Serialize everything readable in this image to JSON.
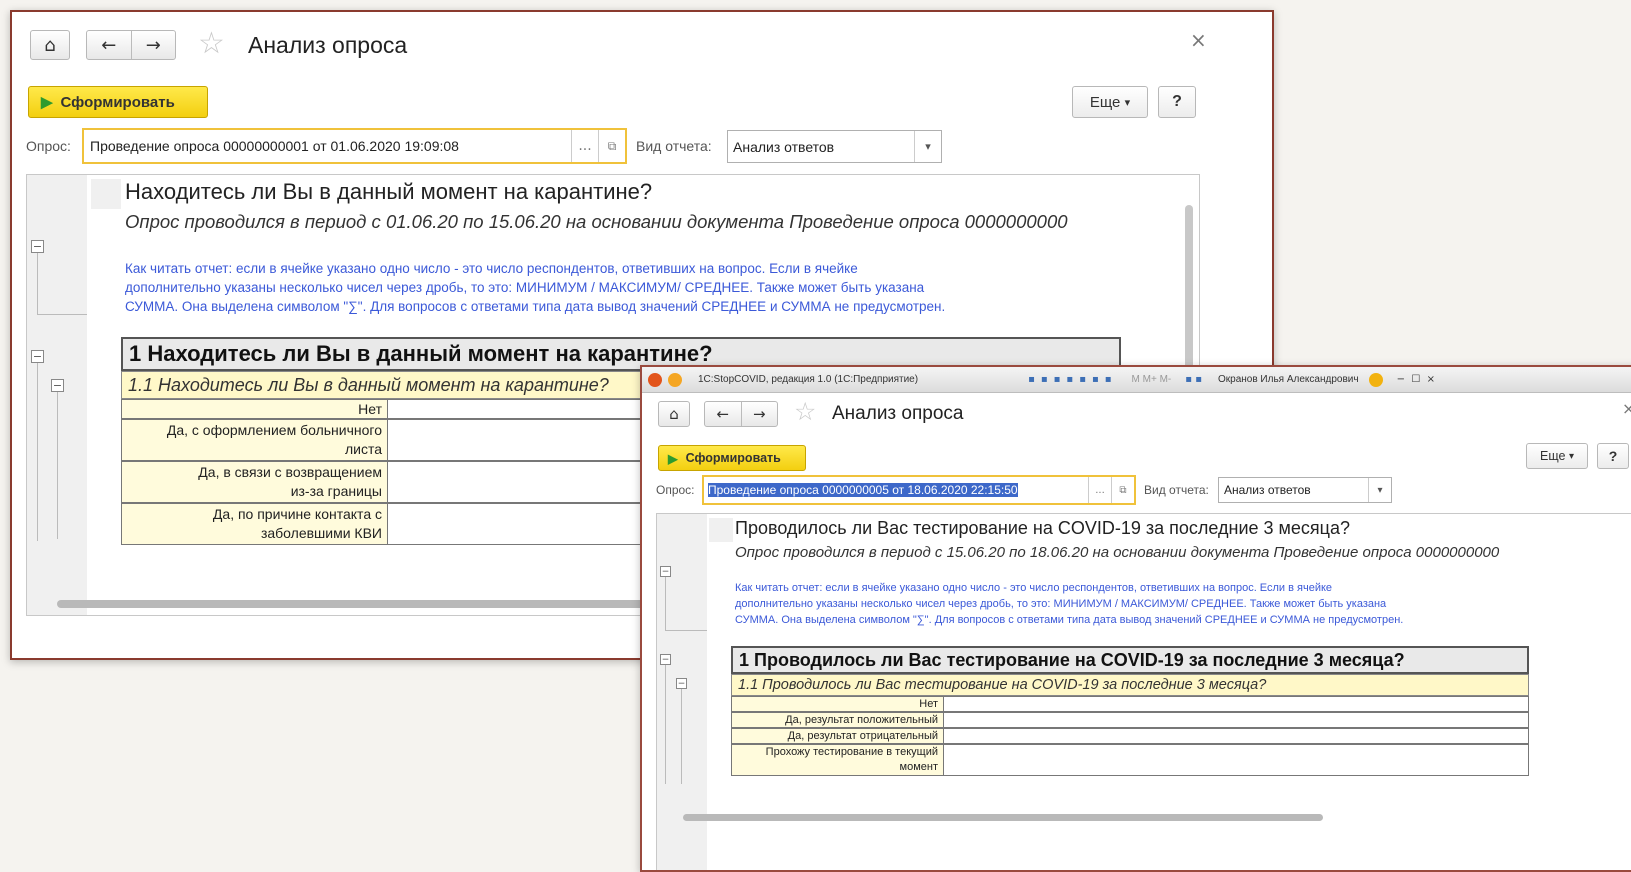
{
  "win1": {
    "title": "Анализ опроса",
    "generate_label": "Сформировать",
    "more_label": "Еще",
    "help_label": "?",
    "survey_label": "Опрос:",
    "survey_value": "Проведение опроса 00000000001 от 01.06.2020 19:09:08",
    "report_type_label": "Вид отчета:",
    "report_type_value": "Анализ ответов",
    "question_title": "Находитесь ли Вы в данный момент на карантине?",
    "question_sub": "Опрос проводился в период с 01.06.20 по 15.06.20 на основании документа Проведение опроса 0000000000",
    "info_line1": "Как читать отчет: если в ячейке указано одно число - это число респондентов, ответивших на вопрос. Если в ячейке",
    "info_line2": "дополнительно указаны несколько чисел через дробь, то это:   МИНИМУМ / МАКСИМУМ/ СРЕДНЕЕ. Также может быть указана",
    "info_line3": "СУММА. Она выделена символом \"∑\". Для вопросов с ответами типа дата вывод значений СРЕДНЕЕ и СУММА не предусмотрен.",
    "section_header": "1 Находитесь ли Вы в данный момент на карантине?",
    "subsection_header": "1.1 Находитесь ли Вы в данный момент на карантине?",
    "rows": [
      [
        "Нет"
      ],
      [
        "Да, с оформлением больничного",
        "листа"
      ],
      [
        "Да, в связи с возвращением",
        "из-за границы"
      ],
      [
        "Да, по причине контакта с",
        "заболевшими КВИ"
      ]
    ]
  },
  "win2": {
    "app_title": "1С:StopCOVID, редакция 1.0  (1С:Предприятие)",
    "toolbar_marks": "M  M+  M-",
    "user_name": "Окранов Илья Александрович",
    "title": "Анализ опроса",
    "generate_label": "Сформировать",
    "more_label": "Еще",
    "help_label": "?",
    "survey_label": "Опрос:",
    "survey_value": "Проведение опроса 0000000005 от 18.06.2020 22:15:50",
    "report_type_label": "Вид отчета:",
    "report_type_value": "Анализ ответов",
    "question_title": "Проводилось ли Вас тестирование на COVID-19 за последние 3 месяца?",
    "question_sub": "Опрос проводился в период с 15.06.20 по 18.06.20 на основании документа Проведение опроса 0000000000",
    "info_line1": "Как читать отчет: если в ячейке указано одно число - это число респондентов, ответивших на вопрос. Если в ячейке",
    "info_line2": "дополнительно указаны несколько чисел через дробь, то это:   МИНИМУМ / МАКСИМУМ/ СРЕДНЕЕ. Также может быть указана",
    "info_line3": "СУММА. Она выделена символом \"∑\". Для вопросов с ответами типа дата вывод значений СРЕДНЕЕ и СУММА не предусмотрен.",
    "section_header": "1 Проводилось ли Вас тестирование на COVID-19 за последние 3 месяца?",
    "subsection_header": "1.1 Проводилось ли Вас тестирование на COVID-19 за последние 3 месяца?",
    "rows": [
      [
        "Нет"
      ],
      [
        "Да, результат положительный"
      ],
      [
        "Да, результат отрицательный"
      ],
      [
        "Прохожу тестирование в текущий",
        "момент"
      ]
    ]
  },
  "icons": {
    "home": "⌂",
    "back": "←",
    "forward": "→",
    "star": "☆",
    "close": "×",
    "play": "▶",
    "dropdown": "▾",
    "ellipsis": "...",
    "link": "🗗",
    "collapse": "−"
  }
}
